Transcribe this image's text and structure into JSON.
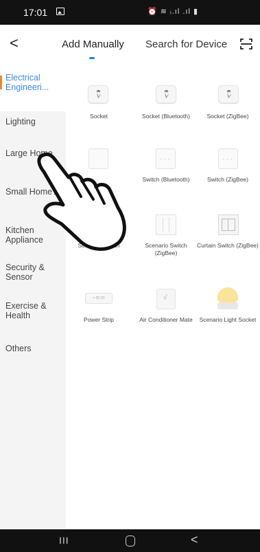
{
  "status_bar": {
    "time": "17:01",
    "icons": "⏰ ≋ ᵢ.ıl .ıl ▮"
  },
  "header": {
    "back": "<",
    "tab_manual": "Add Manually",
    "tab_search": "Search for Device"
  },
  "sidebar": {
    "items": [
      {
        "label": "Electrical Engineeri..."
      },
      {
        "label": "Lighting"
      },
      {
        "label": "Large Home"
      },
      {
        "label": "Small Home A"
      },
      {
        "label": "Kitchen Appliance"
      },
      {
        "label": "Security & Sensor"
      },
      {
        "label": "Exercise & Health"
      },
      {
        "label": "Others"
      }
    ]
  },
  "devices": [
    {
      "label": "Socket",
      "icon": "socket"
    },
    {
      "label": "Socket (Bluetooth)",
      "icon": "socket"
    },
    {
      "label": "Socket (ZigBee)",
      "icon": "socket"
    },
    {
      "label": "",
      "icon": "switch"
    },
    {
      "label": "Switch (Bluetooth)",
      "icon": "switch"
    },
    {
      "label": "Switch (ZigBee)",
      "icon": "switch"
    },
    {
      "label": "Scenario Switch",
      "icon": "scene-switch"
    },
    {
      "label": "Scenario Switch (ZigBee)",
      "icon": "scene-switch"
    },
    {
      "label": "Curtain Switch (ZigBee)",
      "icon": "curtain-switch"
    },
    {
      "label": "Power Strip",
      "icon": "power-strip"
    },
    {
      "label": "Air Conditioner Mate",
      "icon": "ac-mate"
    },
    {
      "label": "Scenario Light Socket",
      "icon": "light-socket"
    }
  ],
  "power_strip_text": "▫ ⁝⁝⁝ ⁝⁝⁝",
  "switch_dots": "- - -",
  "navbar": {
    "recents": "III",
    "back": "<"
  },
  "colors": {
    "accent": "#1e88e5",
    "active_marker": "#e88b2e",
    "sidebar_bg": "#f4f4f4"
  }
}
